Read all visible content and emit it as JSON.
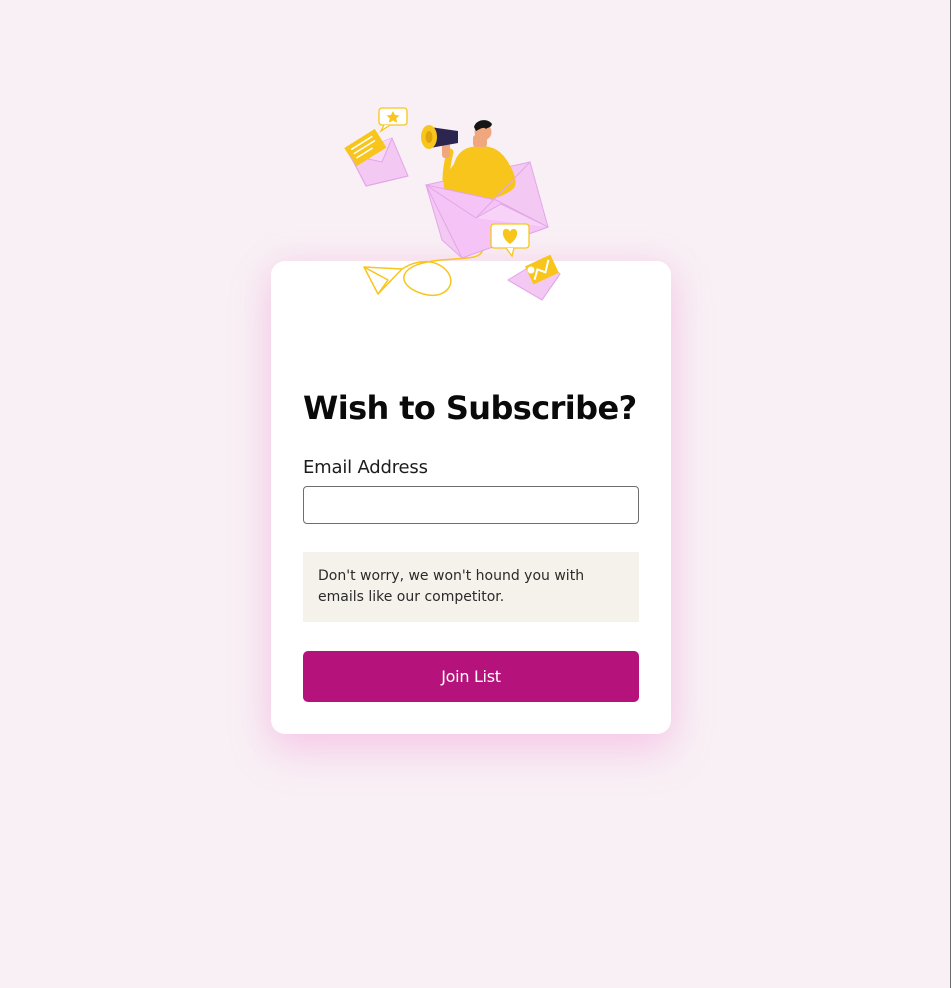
{
  "form": {
    "title": "Wish to Subscribe?",
    "email_label": "Email Address",
    "email_value": "",
    "email_placeholder": "",
    "note": "Don't worry, we won't hound you with emails like our competitor.",
    "button_label": "Join List"
  },
  "illustration": {
    "icons": [
      "megaphone-person-icon",
      "envelope-icon",
      "paper-plane-icon",
      "star-bubble-icon",
      "heart-bubble-icon"
    ]
  },
  "colors": {
    "background": "#f8f0f5",
    "card": "#ffffff",
    "accent": "#b5137b",
    "note_background": "#f5f1eb",
    "illustration_yellow": "#f8c51c",
    "illustration_pink": "#f3c9f3"
  }
}
